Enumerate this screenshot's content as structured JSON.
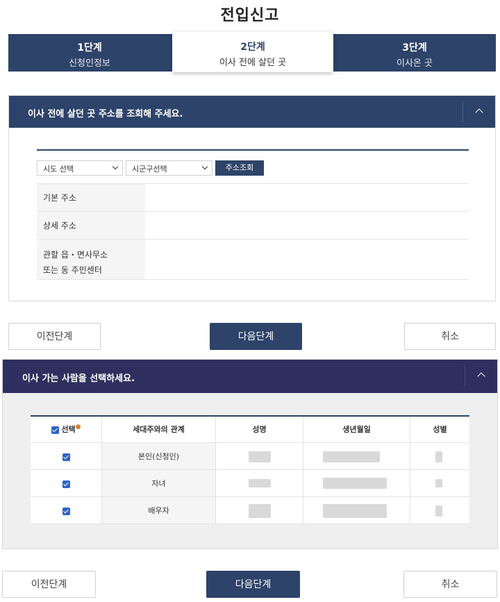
{
  "page_title": "전입신고",
  "steps": [
    {
      "num": "1단계",
      "label": "신청인정보"
    },
    {
      "num": "2단계",
      "label": "이사 전에 살던 곳"
    },
    {
      "num": "3단계",
      "label": "이사온 곳"
    }
  ],
  "active_step": 2,
  "address_panel": {
    "title": "이사 전에 살던 곳 주소를 조회해 주세요.",
    "sido_select": "시도 선택",
    "sigungu_select": "시군구선택",
    "lookup_button": "주소조회",
    "rows": [
      {
        "label": "기본 주소",
        "value": ""
      },
      {
        "label": "상세 주소",
        "value": ""
      },
      {
        "label_line1": "관할 읍・면사무소",
        "label_line2": "또는 동 주민센터",
        "value": ""
      }
    ]
  },
  "nav1": {
    "prev": "이전단계",
    "next": "다음단계",
    "cancel": "취소"
  },
  "movers_panel": {
    "title": "이사 가는 사람을 선택하세요.",
    "columns": {
      "select": "선택",
      "relation": "세대주와의 관계",
      "name": "성명",
      "birth": "생년월일",
      "gender": "성별"
    },
    "people": [
      {
        "checked": true,
        "relation": "본인(신청인)"
      },
      {
        "checked": true,
        "relation": "자녀"
      },
      {
        "checked": true,
        "relation": "배우자"
      }
    ]
  },
  "nav2": {
    "prev": "이전단계",
    "next": "다음단계",
    "cancel": "취소"
  },
  "colors": {
    "navy": "#2e4369",
    "indigo": "#2f2f5f",
    "checkbox": "#2e62c9"
  },
  "icons": {
    "collapse": "chevron-up-icon",
    "select": "chevron-down-icon",
    "check": "checkbox-checked-icon"
  }
}
